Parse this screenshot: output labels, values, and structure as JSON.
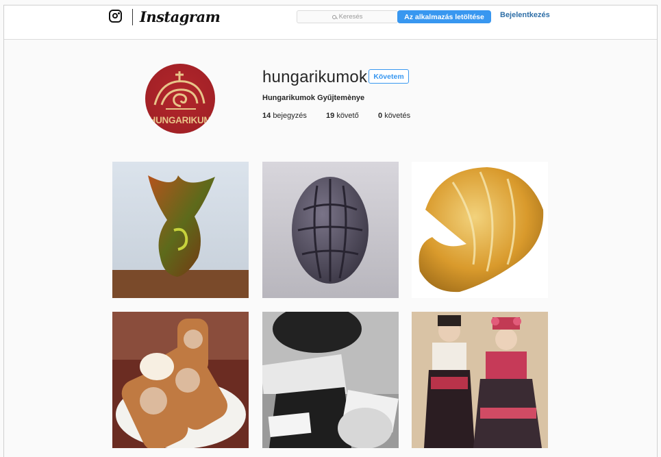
{
  "app": {
    "name": "Instagram"
  },
  "header": {
    "wordmark": "Instagram",
    "search_placeholder": "Keresés",
    "download_button": "Az alkalmazás letöltése",
    "login_link": "Bejelentkezés"
  },
  "profile": {
    "username": "hungarikumok",
    "follow_button": "Követem",
    "full_name": "Hungarikumok Gyűjtemènye",
    "avatar_text": "HUNGARIKUM",
    "stats": {
      "posts_count": "14",
      "posts_label": "bejegyzés",
      "followers_count": "19",
      "followers_label": "követő",
      "following_count": "0",
      "following_label": "követés"
    }
  },
  "posts": [
    {
      "subject": "iridescent Zsolnay vase"
    },
    {
      "subject": "openwork porcelain egg"
    },
    {
      "subject": "golden shell-shaped dish"
    },
    {
      "subject": "chimney cakes"
    },
    {
      "subject": "black and white memorabilia"
    },
    {
      "subject": "folk costume dolls"
    }
  ],
  "colors": {
    "accent": "#3897f0",
    "avatar_bg": "#9c1f24",
    "avatar_gold": "#e8c489"
  }
}
